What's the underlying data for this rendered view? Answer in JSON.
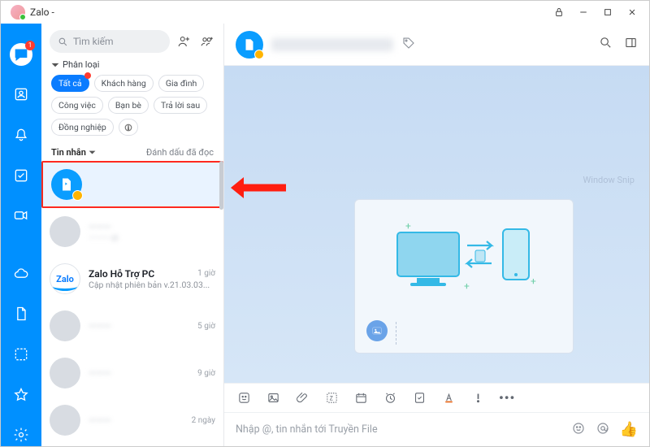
{
  "app_title": "Zalo -",
  "search": {
    "placeholder": "Tìm kiếm"
  },
  "rail": {
    "chat_badge": "1"
  },
  "filters": {
    "heading": "Phân loại",
    "items": [
      "Tất cả",
      "Khách hàng",
      "Gia đình",
      "Công việc",
      "Bạn bè",
      "Trả lời sau",
      "Đồng nghiệp"
    ]
  },
  "messages_header": {
    "label": "Tin nhắn",
    "mark_read": "Đánh dấu đã đọc"
  },
  "conversations": [
    {
      "name": "",
      "time": "",
      "preview": ""
    },
    {
      "name": "———",
      "time": "",
      "preview": "———  út"
    },
    {
      "name": "Zalo Hỗ Trợ PC",
      "time": "1 giờ",
      "preview": "Cập nhật phiên bản v.21.03.03..."
    },
    {
      "name": "———",
      "time": "5 giờ",
      "preview": ""
    },
    {
      "name": "———",
      "time": "9 giờ",
      "preview": ""
    },
    {
      "name": "———",
      "time": "2 ngày",
      "preview": ""
    }
  ],
  "chat": {
    "watermark": "Window Snip",
    "input_placeholder": "Nhập @, tin nhắn tới Truyền File"
  }
}
